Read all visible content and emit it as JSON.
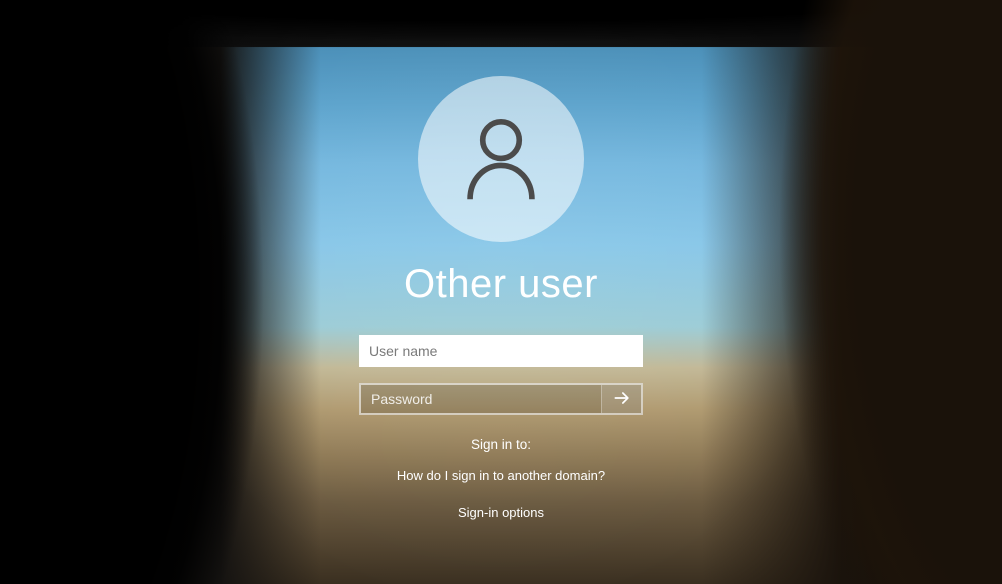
{
  "account_name": "Other user",
  "fields": {
    "username": {
      "placeholder": "User name",
      "value": ""
    },
    "password": {
      "placeholder": "Password",
      "value": ""
    }
  },
  "labels": {
    "sign_in_to": "Sign in to:",
    "other_domain_link": "How do I sign in to another domain?",
    "sign_in_options": "Sign-in options"
  }
}
